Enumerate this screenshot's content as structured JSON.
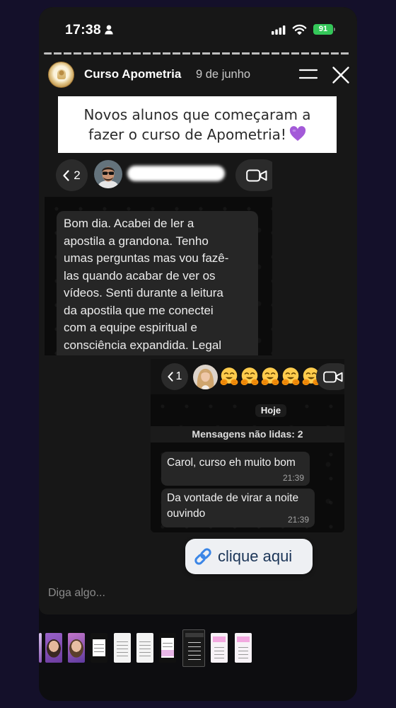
{
  "status_bar": {
    "time": "17:38",
    "battery_level": "91",
    "icons": [
      "person-icon",
      "cellular-signal-icon",
      "wifi-icon",
      "battery-icon"
    ]
  },
  "story": {
    "author": "Curso Apometria",
    "date": "9 de junho",
    "header_icons": [
      "menu-icon",
      "close-icon"
    ],
    "caption": {
      "lines": [
        "Novos alunos que começaram a",
        "fazer o curso de Apometria!"
      ],
      "emoji_icon": "purple-heart-icon"
    }
  },
  "screenshot_1": {
    "back_count": "2",
    "back_icon": "chevron-left-icon",
    "call_icon": "video-call-icon",
    "message_lines": [
      "Bom dia. Acabei de ler a",
      "apostila a grandona. Tenho",
      "umas perguntas mas vou fazê-",
      "las quando acabar de ver os",
      "vídeos. Senti durante a leitura",
      "da apostila que me conectei",
      "com a equipe espiritual e",
      "consciência expandida. Legal"
    ]
  },
  "screenshot_2": {
    "back_count": "1",
    "back_icon": "chevron-left-icon",
    "header_emoji_icons": [
      "hugging-face-icon",
      "hugging-face-icon",
      "hugging-face-icon",
      "hugging-face-icon",
      "hugging-face-icon"
    ],
    "call_icon": "video-call-icon",
    "date_chip": "Hoje",
    "unread_banner": "Mensagens não lidas: 2",
    "messages": [
      {
        "lines": [
          "Carol, curso eh muito bom"
        ],
        "time": "21:39"
      },
      {
        "lines": [
          "Da vontade de virar a noite",
          "ouvindo"
        ],
        "time": "21:39"
      }
    ]
  },
  "link_sticker": {
    "label": "clique aqui",
    "icon": "link-icon"
  },
  "reply": {
    "placeholder": "Diga algo..."
  },
  "colors": {
    "page_background": "#14102a",
    "battery_green": "#34c759",
    "link_blue": "#3b86e6",
    "heart_purple": "#a35ad8"
  }
}
